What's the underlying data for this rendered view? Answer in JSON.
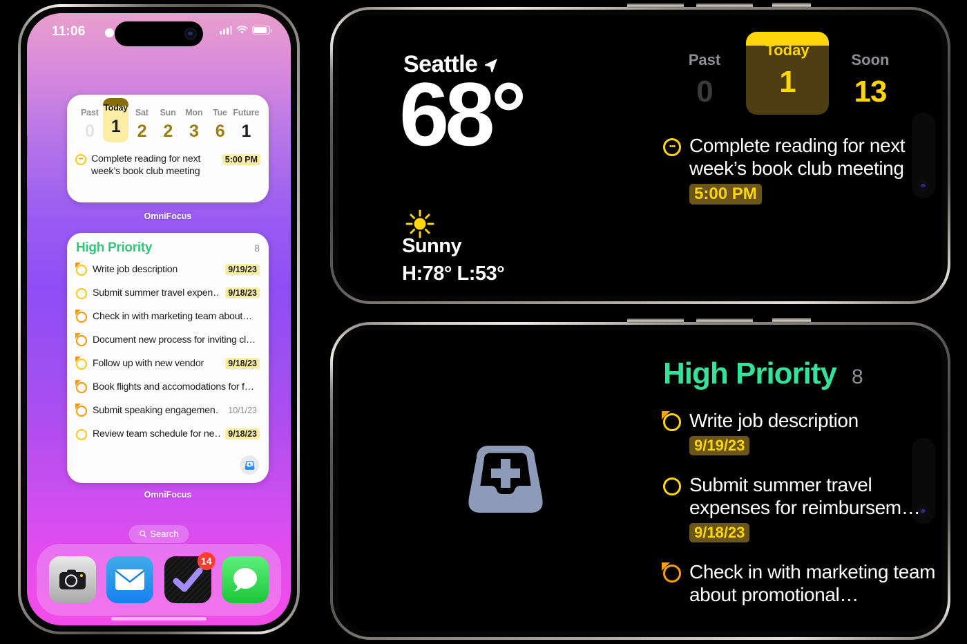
{
  "scene": {
    "background_color": "#000000"
  },
  "phone_portrait": {
    "name": "iPhone home screen portrait",
    "status_bar": {
      "time": "11:06",
      "recording_indicator": "recording-dot",
      "cellular": "cellular-bars-icon",
      "wifi": "wifi-icon",
      "battery": "battery-icon"
    },
    "wallpaper_colors": {
      "top": "#e89fcd",
      "middle": "#8f4ef5",
      "bottom": "#f24ce8"
    },
    "forecast_widget": {
      "label": "OmniFocus",
      "columns": [
        {
          "name": "Past",
          "count": "0",
          "state": "dim"
        },
        {
          "name": "Today",
          "count": "1",
          "state": "today"
        },
        {
          "name": "Sat",
          "count": "2",
          "state": "normal"
        },
        {
          "name": "Sun",
          "count": "2",
          "state": "normal"
        },
        {
          "name": "Mon",
          "count": "3",
          "state": "normal"
        },
        {
          "name": "Tue",
          "count": "6",
          "state": "normal"
        },
        {
          "name": "Future",
          "count": "1",
          "state": "future"
        }
      ],
      "task": {
        "icon": "circle-dots-icon",
        "text": "Complete reading for next week’s book club meeting",
        "time": "5:00 PM"
      }
    },
    "priority_widget": {
      "label": "OmniFocus",
      "title": "High Priority",
      "count": "8",
      "add_button_icon": "inbox-plus-icon",
      "items": [
        {
          "icon": "circle-repeat-icon",
          "text": "Write job description",
          "date": "9/19/23",
          "date_style": "highlight"
        },
        {
          "icon": "circle-icon",
          "text": "Submit summer travel expen…",
          "date": "9/18/23",
          "date_style": "highlight"
        },
        {
          "icon": "circle-repeat-icon",
          "text": "Check in with marketing team about…",
          "date": "",
          "date_style": "none"
        },
        {
          "icon": "circle-repeat-icon",
          "text": "Document new process for inviting cl…",
          "date": "",
          "date_style": "none"
        },
        {
          "icon": "circle-repeat-icon",
          "text": "Follow up with new vendor",
          "date": "9/18/23",
          "date_style": "highlight"
        },
        {
          "icon": "circle-repeat-icon",
          "text": "Book flights and accomodations for f…",
          "date": "",
          "date_style": "none"
        },
        {
          "icon": "circle-repeat-icon",
          "text": "Submit speaking engagemen…",
          "date": "10/1/23",
          "date_style": "plain"
        },
        {
          "icon": "circle-icon",
          "text": "Review team schedule for ne…",
          "date": "9/18/23",
          "date_style": "highlight"
        }
      ]
    },
    "search_pill": {
      "icon": "search-icon",
      "label": "Search"
    },
    "dock": [
      {
        "name": "camera-app-icon",
        "label": "Camera",
        "badge": ""
      },
      {
        "name": "mail-app-icon",
        "label": "Mail",
        "badge": ""
      },
      {
        "name": "things-app-icon",
        "label": "Things",
        "badge": "14"
      },
      {
        "name": "messages-app-icon",
        "label": "Messages",
        "badge": ""
      }
    ]
  },
  "phone_landscape_top": {
    "weather": {
      "city": "Seattle",
      "location_icon": "location-arrow-icon",
      "temperature": "68°",
      "condition_icon": "sun-icon",
      "condition": "Sunny",
      "high_low": "H:78° L:53°"
    },
    "forecast": {
      "columns": [
        {
          "name": "Past",
          "count": "0",
          "state": "dim"
        },
        {
          "name": "Today",
          "count": "1",
          "state": "today"
        },
        {
          "name": "Soon",
          "count": "13",
          "state": "normal"
        }
      ],
      "task": {
        "icon": "circle-dots-icon",
        "text": "Complete reading for next week’s book club meeting",
        "time": "5:00 PM"
      }
    }
  },
  "phone_landscape_bottom": {
    "inbox_icon": "inbox-plus-icon",
    "priority": {
      "title": "High Priority",
      "count": "8",
      "items": [
        {
          "icon": "circle-repeat-icon",
          "text": "Write job description",
          "date": "9/19/23"
        },
        {
          "icon": "circle-icon",
          "text": "Submit summer travel expenses for reimbursem…",
          "date": "9/18/23"
        },
        {
          "icon": "circle-repeat-icon",
          "text": "Check in with marketing team about promotional…",
          "date": ""
        }
      ]
    }
  },
  "accent_colors": {
    "yellow": "#ffd60a",
    "orange": "#ff9f0a",
    "green": "#35e29a",
    "badge_red": "#ff3b30",
    "today_pill_dark": "#4e3e12",
    "date_chip_dark": "#6b5518",
    "date_chip_light": "#fbeea4"
  }
}
